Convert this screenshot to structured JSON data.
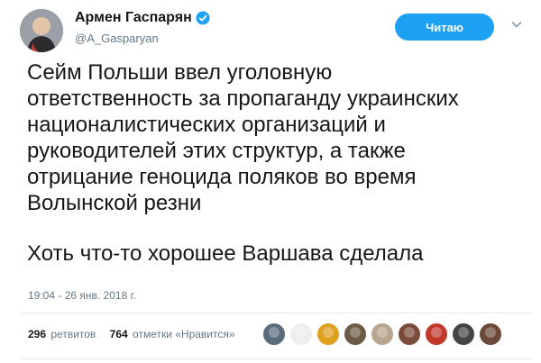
{
  "author": {
    "name": "Армен Гаспарян",
    "handle": "@A_Gasparyan",
    "verified": true
  },
  "follow_button": {
    "label": "Читаю"
  },
  "tweet": {
    "paragraph1": [
      "Сейм Польши ввел уголовную",
      "ответственность за пропаганду украинских",
      "националистических организаций и",
      "руководителей этих структур, а также",
      "отрицание геноцида поляков во время",
      "Волынской резни"
    ],
    "paragraph2": "Хоть что-то хорошее Варшава сделала",
    "timestamp": "19:04 - 26 янв. 2018 г."
  },
  "stats": {
    "retweets_count": "296",
    "retweets_label": "ретвитов",
    "likes_count": "764",
    "likes_label": "отметки «Нравится»"
  },
  "likers": [
    {
      "icon": "avatar-swirl",
      "color": "#5a6b7c"
    },
    {
      "icon": "avatar-j-tag",
      "color": "#eeeeee"
    },
    {
      "icon": "avatar-dog",
      "color": "#e0a020"
    },
    {
      "icon": "avatar-bear",
      "color": "#6b5a45"
    },
    {
      "icon": "avatar-face",
      "color": "#b8a58f"
    },
    {
      "icon": "avatar-woman",
      "color": "#7a4b3a"
    },
    {
      "icon": "avatar-red-circle",
      "color": "#c0392b"
    },
    {
      "icon": "avatar-bw",
      "color": "#444444"
    },
    {
      "icon": "avatar-flag",
      "color": "#6b4a3a"
    }
  ],
  "colors": {
    "accent": "#1da1f2",
    "text": "#14171a",
    "secondary": "#657786"
  }
}
